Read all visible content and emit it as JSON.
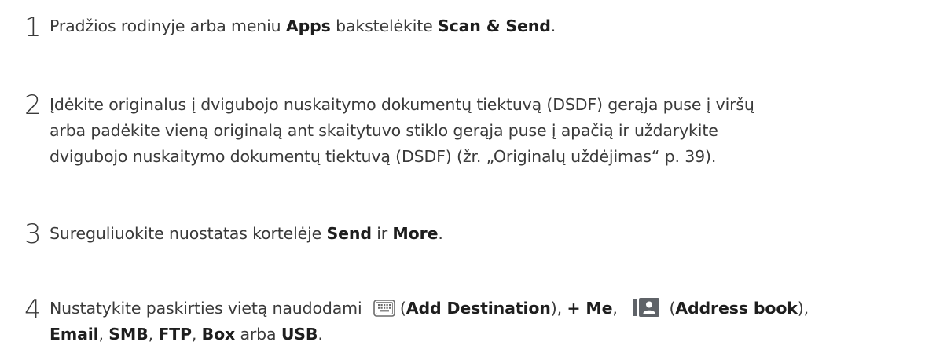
{
  "steps": [
    {
      "number": "1",
      "line1": {
        "t1": "Pradžios rodinyje arba meniu ",
        "b1": "Apps",
        "t2": " bakstelėkite ",
        "b2": "Scan & Send",
        "t3": "."
      }
    },
    {
      "number": "2",
      "lines": [
        "Įdėkite originalus į dvigubojo nuskaitymo dokumentų tiektuvą (DSDF) gerąja puse į viršų",
        "arba padėkite vieną originalą ant skaitytuvo stiklo gerąja puse į apačią ir uždarykite",
        "dvigubojo nuskaitymo dokumentų tiektuvą (DSDF) (žr. „Originalų uždėjimas“ p. 39)."
      ]
    },
    {
      "number": "3",
      "line1": {
        "t1": "Sureguliuokite nuostatas kortelėje ",
        "b1": "Send",
        "t2": " ir ",
        "b2": "More",
        "t3": "."
      }
    },
    {
      "number": "4",
      "line1": {
        "t1": "Nustatykite paskirties vietą naudodami ",
        "icon1": "keyboard-icon",
        "t2": "(",
        "b1": "Add Destination",
        "t3": "), ",
        "b2": "+ Me",
        "t4": ", ",
        "icon2": "address-book-icon",
        "t5": " (",
        "b3": "Address book",
        "t6": "),"
      },
      "line2": {
        "b1": "Email",
        "t1": ", ",
        "b2": "SMB",
        "t2": ", ",
        "b3": "FTP",
        "t3": ", ",
        "b4": "Box",
        "t4": " arba ",
        "b5": "USB",
        "t5": "."
      }
    }
  ],
  "colors": {
    "text": "#3a3a3a",
    "icon_gray": "#5f6368",
    "icon_bg": "#ffffff"
  }
}
